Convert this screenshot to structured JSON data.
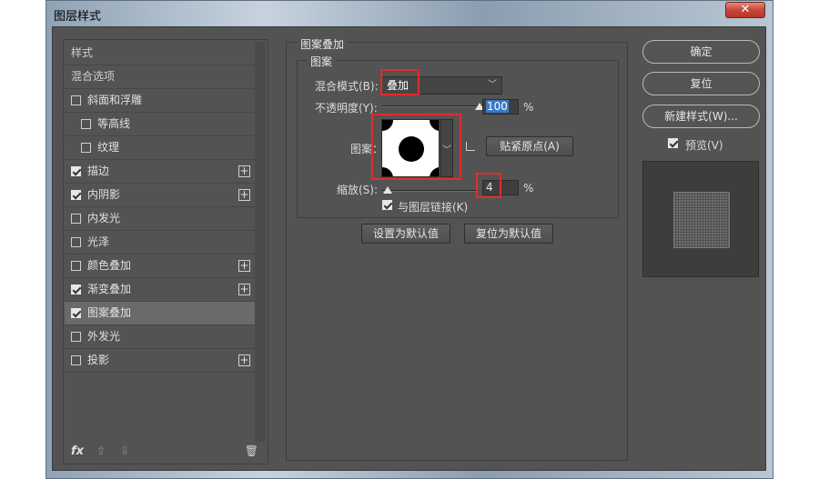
{
  "window": {
    "title": "图层样式",
    "close": "✕"
  },
  "styles": {
    "header": "样式",
    "blend_options": "混合选项",
    "items": [
      {
        "label": "斜面和浮雕",
        "checked": false,
        "indent": false,
        "plus": false
      },
      {
        "label": "等高线",
        "checked": false,
        "indent": true,
        "plus": false
      },
      {
        "label": "纹理",
        "checked": false,
        "indent": true,
        "plus": false
      },
      {
        "label": "描边",
        "checked": true,
        "indent": false,
        "plus": true
      },
      {
        "label": "内阴影",
        "checked": true,
        "indent": false,
        "plus": true
      },
      {
        "label": "内发光",
        "checked": false,
        "indent": false,
        "plus": false
      },
      {
        "label": "光泽",
        "checked": false,
        "indent": false,
        "plus": false
      },
      {
        "label": "颜色叠加",
        "checked": false,
        "indent": false,
        "plus": true
      },
      {
        "label": "渐变叠加",
        "checked": true,
        "indent": false,
        "plus": true
      },
      {
        "label": "图案叠加",
        "checked": true,
        "indent": false,
        "plus": false,
        "selected": true
      },
      {
        "label": "外发光",
        "checked": false,
        "indent": false,
        "plus": false
      },
      {
        "label": "投影",
        "checked": false,
        "indent": false,
        "plus": true
      }
    ],
    "footer": {
      "fx": "fx",
      "up": "⇧",
      "down": "⇩",
      "trash": "🗑"
    }
  },
  "pattern_overlay": {
    "group_title": "图案叠加",
    "subgroup_title": "图案",
    "blend_mode_label": "混合模式(B):",
    "blend_mode_value": "叠加",
    "opacity_label": "不透明度(Y):",
    "opacity_value": "100",
    "opacity_unit": "%",
    "opacity_level": 1.0,
    "pattern_label": "图案：",
    "snap_button": "贴紧原点(A)",
    "scale_label": "缩放(S):",
    "scale_value": "4",
    "scale_unit": "%",
    "scale_level": 0.0,
    "link_label": "与图层链接(K)",
    "link_checked": true,
    "set_default": "设置为默认值",
    "reset_default": "复位为默认值"
  },
  "actions": {
    "ok": "确定",
    "reset": "复位",
    "new_style": "新建样式(W)...",
    "preview_label": "预览(V)",
    "preview_checked": true
  },
  "colors": {
    "highlight_red": "#e32b2b",
    "panel_bg": "#535353",
    "selection_blue": "#3a79c6"
  }
}
